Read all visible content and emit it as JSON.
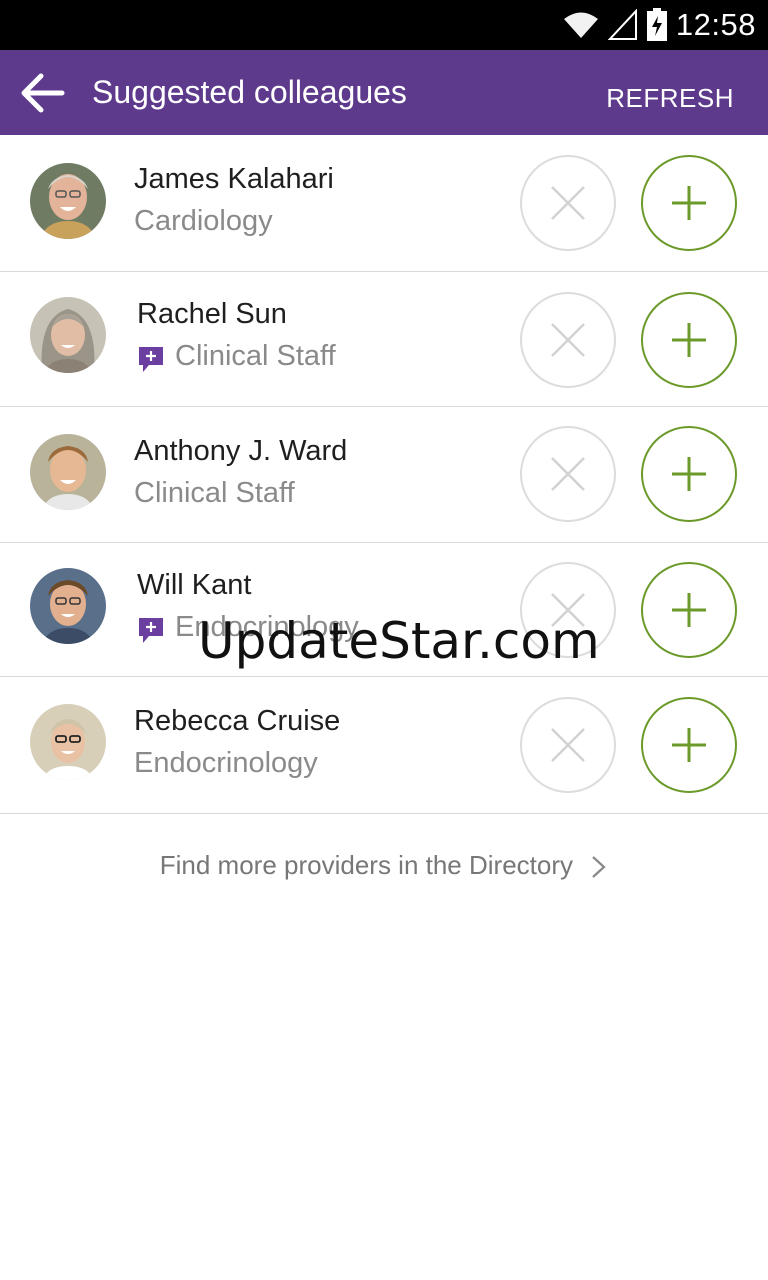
{
  "status_bar": {
    "time": "12:58",
    "icons": [
      "wifi-icon",
      "cell-signal-icon",
      "battery-charging-icon"
    ]
  },
  "app_bar": {
    "title": "Suggested colleagues",
    "refresh_label": "REFRESH",
    "back_icon": "arrow-left-icon",
    "color": "#5e3a8c"
  },
  "colleagues": [
    {
      "name": "James Kalahari",
      "department": "Cardiology",
      "has_message_badge": false
    },
    {
      "name": "Rachel Sun",
      "department": "Clinical Staff",
      "has_message_badge": true
    },
    {
      "name": "Anthony J. Ward",
      "department": "Clinical Staff",
      "has_message_badge": false
    },
    {
      "name": "Will Kant",
      "department": "Endocrinology",
      "has_message_badge": true
    },
    {
      "name": "Rebecca Cruise",
      "department": "Endocrinology",
      "has_message_badge": false
    }
  ],
  "directory_link": "Find more providers in the Directory",
  "watermark": "UpdateStar.com",
  "colors": {
    "accent_purple": "#5e3a8c",
    "add_green": "#6b9a2a",
    "dismiss_gray": "#dcdcdc"
  }
}
